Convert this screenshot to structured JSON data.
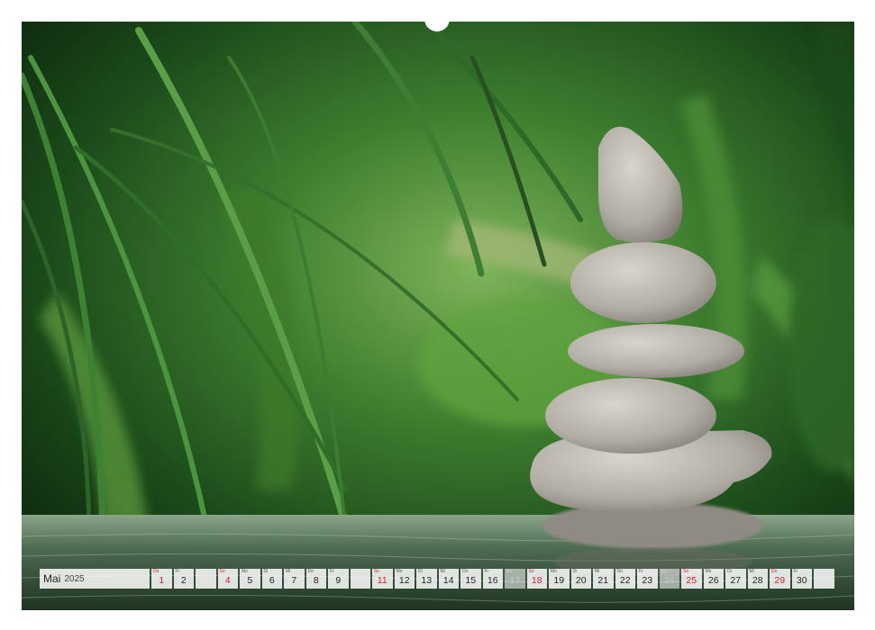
{
  "calendar": {
    "month": "Mai",
    "year": "2025",
    "days": [
      {
        "wd": "Do",
        "n": "1",
        "type": "holiday"
      },
      {
        "wd": "Fr",
        "n": "2",
        "type": "normal"
      },
      {
        "wd": "",
        "n": "",
        "type": "blank"
      },
      {
        "wd": "So",
        "n": "4",
        "type": "sunday"
      },
      {
        "wd": "Mo",
        "n": "5",
        "type": "normal"
      },
      {
        "wd": "Di",
        "n": "6",
        "type": "normal"
      },
      {
        "wd": "Mi",
        "n": "7",
        "type": "normal"
      },
      {
        "wd": "Do",
        "n": "8",
        "type": "normal"
      },
      {
        "wd": "Fr",
        "n": "9",
        "type": "normal"
      },
      {
        "wd": "",
        "n": "",
        "type": "blank"
      },
      {
        "wd": "So",
        "n": "11",
        "type": "sunday"
      },
      {
        "wd": "Mo",
        "n": "12",
        "type": "normal"
      },
      {
        "wd": "Di",
        "n": "13",
        "type": "normal"
      },
      {
        "wd": "Mi",
        "n": "14",
        "type": "normal"
      },
      {
        "wd": "Do",
        "n": "15",
        "type": "normal"
      },
      {
        "wd": "Fr",
        "n": "16",
        "type": "normal"
      },
      {
        "wd": "Sa",
        "n": "17",
        "type": "faded"
      },
      {
        "wd": "So",
        "n": "18",
        "type": "sunday"
      },
      {
        "wd": "Mo",
        "n": "19",
        "type": "normal"
      },
      {
        "wd": "Di",
        "n": "20",
        "type": "normal"
      },
      {
        "wd": "Mi",
        "n": "21",
        "type": "normal"
      },
      {
        "wd": "Do",
        "n": "22",
        "type": "normal"
      },
      {
        "wd": "Fr",
        "n": "23",
        "type": "normal"
      },
      {
        "wd": "Sa",
        "n": "24",
        "type": "faded"
      },
      {
        "wd": "So",
        "n": "25",
        "type": "sunday"
      },
      {
        "wd": "Mo",
        "n": "26",
        "type": "normal"
      },
      {
        "wd": "Di",
        "n": "27",
        "type": "normal"
      },
      {
        "wd": "Mi",
        "n": "28",
        "type": "normal"
      },
      {
        "wd": "Do",
        "n": "29",
        "type": "holiday"
      },
      {
        "wd": "Fr",
        "n": "30",
        "type": "normal"
      },
      {
        "wd": "",
        "n": "",
        "type": "blank"
      }
    ]
  },
  "colors": {
    "holiday": "#d21f2a",
    "foliage": "#2f7a2c",
    "stone": "#b8b4ac"
  }
}
